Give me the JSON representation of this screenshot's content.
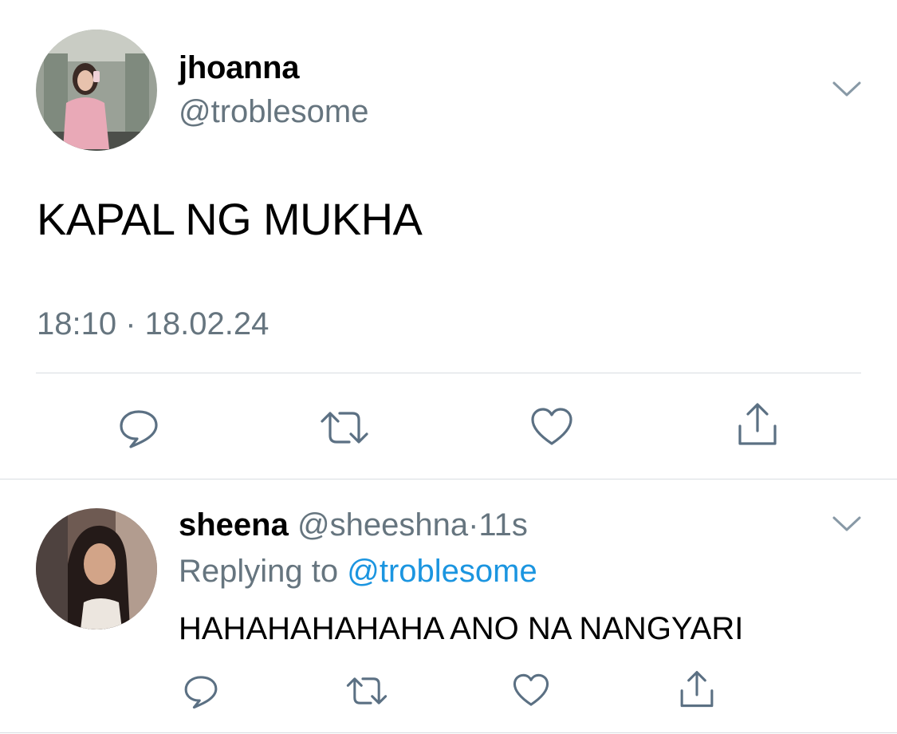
{
  "main_tweet": {
    "author": {
      "display_name": "jhoanna",
      "handle": "@troblesome",
      "avatar": "profile-photo"
    },
    "text": "KAPAL NG MUKHA",
    "timestamp": "18:10 · 18.02.24",
    "actions": [
      {
        "icon": "reply-icon"
      },
      {
        "icon": "retweet-icon"
      },
      {
        "icon": "like-icon"
      },
      {
        "icon": "share-icon"
      }
    ]
  },
  "reply": {
    "author": {
      "display_name": "sheena",
      "handle": "@sheeshna",
      "avatar": "profile-photo"
    },
    "separator": "·",
    "age": "11s",
    "replying_prefix": "Replying to",
    "replying_to": "@troblesome",
    "text": "HAHAHAHAHAHA ANO NA NANGYARI",
    "actions": [
      {
        "icon": "reply-icon"
      },
      {
        "icon": "retweet-icon"
      },
      {
        "icon": "like-icon"
      },
      {
        "icon": "share-icon"
      }
    ]
  },
  "colors": {
    "text_primary": "#000000",
    "text_secondary": "#66757f",
    "link": "#1b95e0",
    "divider": "#d8dde1",
    "icon": "#5b7083"
  }
}
